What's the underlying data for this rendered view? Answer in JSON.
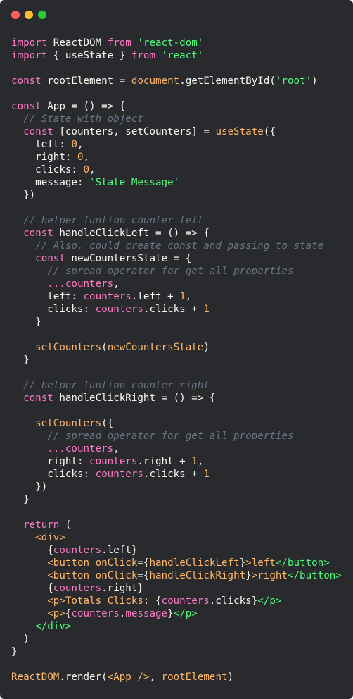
{
  "window": {
    "colors": {
      "close": "#ff5f56",
      "minimize": "#ffbd2e",
      "maximize": "#27c93f",
      "background": "#282a2d"
    }
  },
  "code_lines": [
    [
      [
        "kw",
        "import"
      ],
      [
        "pl",
        " ReactDOM "
      ],
      [
        "kw",
        "from"
      ],
      [
        "pl",
        " "
      ],
      [
        "str",
        "'react-dom'"
      ]
    ],
    [
      [
        "kw",
        "import"
      ],
      [
        "pl",
        " { useState } "
      ],
      [
        "kw",
        "from"
      ],
      [
        "pl",
        " "
      ],
      [
        "str",
        "'react'"
      ]
    ],
    [],
    [
      [
        "kw",
        "const"
      ],
      [
        "pl",
        " rootElement = "
      ],
      [
        "fn",
        "document"
      ],
      [
        "pl",
        ".getElementById("
      ],
      [
        "str",
        "'root'"
      ],
      [
        "pl",
        ")"
      ]
    ],
    [],
    [
      [
        "kw",
        "const"
      ],
      [
        "pl",
        " App = () => {"
      ]
    ],
    [
      [
        "pl",
        "  "
      ],
      [
        "com",
        "// State with object"
      ]
    ],
    [
      [
        "pl",
        "  "
      ],
      [
        "kw",
        "const"
      ],
      [
        "pl",
        " [counters, setCounters] = "
      ],
      [
        "fn",
        "useState"
      ],
      [
        "pl",
        "({"
      ]
    ],
    [
      [
        "pl",
        "    left: "
      ],
      [
        "num",
        "0"
      ],
      [
        "pl",
        ","
      ]
    ],
    [
      [
        "pl",
        "    right: "
      ],
      [
        "num",
        "0"
      ],
      [
        "pl",
        ","
      ]
    ],
    [
      [
        "pl",
        "    clicks: "
      ],
      [
        "num",
        "0"
      ],
      [
        "pl",
        ","
      ]
    ],
    [
      [
        "pl",
        "    message: "
      ],
      [
        "str",
        "'State Message'"
      ]
    ],
    [
      [
        "pl",
        "  })"
      ]
    ],
    [],
    [
      [
        "pl",
        "  "
      ],
      [
        "com",
        "// helper funtion counter left"
      ]
    ],
    [
      [
        "pl",
        "  "
      ],
      [
        "kw",
        "const"
      ],
      [
        "pl",
        " handleClickLeft = () => {"
      ]
    ],
    [
      [
        "pl",
        "    "
      ],
      [
        "com",
        "// Also, could create const and passing to state"
      ]
    ],
    [
      [
        "pl",
        "    "
      ],
      [
        "kw",
        "const"
      ],
      [
        "pl",
        " newCountersState = {"
      ]
    ],
    [
      [
        "pl",
        "      "
      ],
      [
        "com",
        "// spread operator for get all properties"
      ]
    ],
    [
      [
        "pl",
        "      "
      ],
      [
        "ref",
        "...counters"
      ],
      [
        "pl",
        ","
      ]
    ],
    [
      [
        "pl",
        "      left: "
      ],
      [
        "ref",
        "counters"
      ],
      [
        "pl",
        ".left + "
      ],
      [
        "num",
        "1"
      ],
      [
        "pl",
        ","
      ]
    ],
    [
      [
        "pl",
        "      clicks: "
      ],
      [
        "ref",
        "counters"
      ],
      [
        "pl",
        ".clicks + "
      ],
      [
        "num",
        "1"
      ]
    ],
    [
      [
        "pl",
        "    }"
      ]
    ],
    [],
    [
      [
        "pl",
        "    "
      ],
      [
        "fn",
        "setCounters"
      ],
      [
        "pl",
        "("
      ],
      [
        "fn",
        "newCountersState"
      ],
      [
        "pl",
        ")"
      ]
    ],
    [
      [
        "pl",
        "  }"
      ]
    ],
    [],
    [
      [
        "pl",
        "  "
      ],
      [
        "com",
        "// helper funtion counter right"
      ]
    ],
    [
      [
        "pl",
        "  "
      ],
      [
        "kw",
        "const"
      ],
      [
        "pl",
        " handleClickRight = () => {"
      ]
    ],
    [],
    [
      [
        "pl",
        "    "
      ],
      [
        "fn",
        "setCounters"
      ],
      [
        "pl",
        "({"
      ]
    ],
    [
      [
        "pl",
        "      "
      ],
      [
        "com",
        "// spread operator for get all properties"
      ]
    ],
    [
      [
        "pl",
        "      "
      ],
      [
        "ref",
        "...counters"
      ],
      [
        "pl",
        ","
      ]
    ],
    [
      [
        "pl",
        "      right: "
      ],
      [
        "ref",
        "counters"
      ],
      [
        "pl",
        ".right + "
      ],
      [
        "num",
        "1"
      ],
      [
        "pl",
        ","
      ]
    ],
    [
      [
        "pl",
        "      clicks: "
      ],
      [
        "ref",
        "counters"
      ],
      [
        "pl",
        ".clicks + "
      ],
      [
        "num",
        "1"
      ]
    ],
    [
      [
        "pl",
        "    })"
      ]
    ],
    [
      [
        "pl",
        "  }"
      ]
    ],
    [],
    [
      [
        "pl",
        "  "
      ],
      [
        "kw",
        "return"
      ],
      [
        "pl",
        " ("
      ]
    ],
    [
      [
        "pl",
        "    "
      ],
      [
        "tag",
        "<div>"
      ]
    ],
    [
      [
        "pl",
        "      {"
      ],
      [
        "ref",
        "counters"
      ],
      [
        "pl",
        ".left}"
      ]
    ],
    [
      [
        "pl",
        "      "
      ],
      [
        "tag",
        "<button"
      ],
      [
        "pl",
        " "
      ],
      [
        "tag",
        "onClick"
      ],
      [
        "pl",
        "={"
      ],
      [
        "fn",
        "handleClickLeft"
      ],
      [
        "pl",
        "}"
      ],
      [
        "tag",
        ">"
      ],
      [
        "fn",
        "left"
      ],
      [
        "tagend",
        "</button>"
      ]
    ],
    [
      [
        "pl",
        "      "
      ],
      [
        "tag",
        "<button"
      ],
      [
        "pl",
        " "
      ],
      [
        "tag",
        "onClick"
      ],
      [
        "pl",
        "={"
      ],
      [
        "fn",
        "handleClickRight"
      ],
      [
        "pl",
        "}"
      ],
      [
        "tag",
        ">"
      ],
      [
        "fn",
        "right"
      ],
      [
        "tagend",
        "</button>"
      ]
    ],
    [
      [
        "pl",
        "      {"
      ],
      [
        "ref",
        "counters"
      ],
      [
        "pl",
        ".right}"
      ]
    ],
    [
      [
        "pl",
        "      "
      ],
      [
        "tag",
        "<p>"
      ],
      [
        "fn",
        "Totals Clicks: "
      ],
      [
        "pl",
        "{"
      ],
      [
        "ref",
        "counters"
      ],
      [
        "pl",
        ".clicks}"
      ],
      [
        "tagend",
        "</p>"
      ]
    ],
    [
      [
        "pl",
        "      "
      ],
      [
        "tag",
        "<p>"
      ],
      [
        "pl",
        "{"
      ],
      [
        "ref",
        "counters"
      ],
      [
        "pl",
        "."
      ],
      [
        "ref",
        "message"
      ],
      [
        "pl",
        "}"
      ],
      [
        "tagend",
        "</p>"
      ]
    ],
    [
      [
        "pl",
        "    "
      ],
      [
        "tagend",
        "</div>"
      ]
    ],
    [
      [
        "pl",
        "  )"
      ]
    ],
    [
      [
        "pl",
        "}"
      ]
    ],
    [],
    [
      [
        "fn",
        "ReactDOM"
      ],
      [
        "pl",
        ".render("
      ],
      [
        "tag",
        "<App />"
      ],
      [
        "pl",
        ", "
      ],
      [
        "fn",
        "rootElement"
      ],
      [
        "pl",
        ")"
      ]
    ]
  ]
}
